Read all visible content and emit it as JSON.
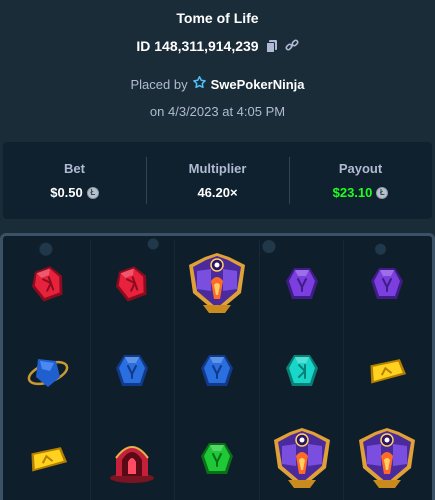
{
  "header": {
    "title": "Tome of Life",
    "id_text": "ID 148,311,914,239",
    "placed_by_prefix": "Placed by",
    "username": "SwePokerNinja",
    "date_text": "on 4/3/2023 at 4:05 PM"
  },
  "stats": {
    "bet_label": "Bet",
    "bet_value": "$0.50",
    "multiplier_label": "Multiplier",
    "multiplier_value": "46.20×",
    "payout_label": "Payout",
    "payout_value": "$23.10"
  },
  "colors": {
    "payout": "#1fff20",
    "background": "#1a2c38",
    "panel": "#0f212e"
  },
  "board": {
    "rows": [
      [
        "red-gem",
        "red-gem",
        "tome-wild",
        "purple-gem",
        "purple-gem"
      ],
      [
        "blue-scarab",
        "blue-gem",
        "blue-gem",
        "cyan-gem",
        "yellow-gem"
      ],
      [
        "yellow-gem",
        "red-arch",
        "green-gem",
        "tome-wild",
        "tome-wild"
      ]
    ]
  }
}
